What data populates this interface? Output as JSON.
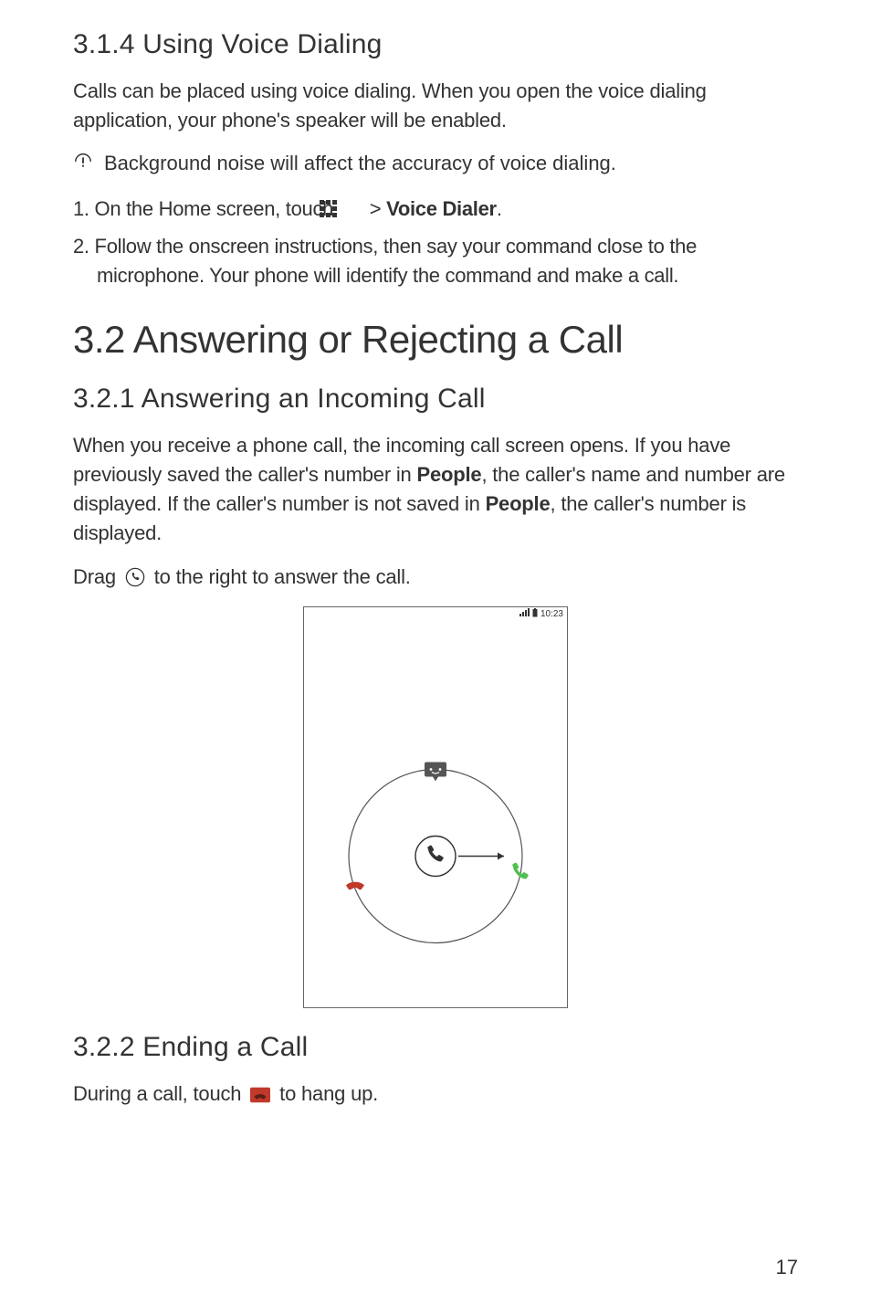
{
  "section314": {
    "heading": "3.1.4  Using Voice Dialing",
    "para1": "Calls can be placed using voice dialing. When you open the voice dialing application, your phone's speaker will be enabled.",
    "note": "Background noise will affect the accuracy of voice dialing.",
    "step1_prefix": "1. On the Home screen, touch ",
    "step1_sep": "  > ",
    "step1_bold": "Voice Dialer",
    "step1_suffix": ".",
    "step2": "2. Follow the onscreen instructions, then say your command close to the microphone. Your phone will identify the command and make a call."
  },
  "section32": {
    "heading": "3.2  Answering or Rejecting a Call"
  },
  "section321": {
    "heading": "3.2.1  Answering an Incoming Call",
    "para_a": "When you receive a phone call, the incoming call screen opens. If you have previously saved the caller's number in ",
    "bold1": "People",
    "para_b": ", the caller's name and number are displayed. If the caller's number is not saved in ",
    "bold2": "People",
    "para_c": ", the caller's number is displayed.",
    "drag_a": "Drag ",
    "drag_b": " to the right to answer the call."
  },
  "phone": {
    "time": "10:23"
  },
  "section322": {
    "heading": "3.2.2  Ending a Call",
    "text_a": "During a call, touch ",
    "text_b": " to hang up."
  },
  "page_number": "17"
}
